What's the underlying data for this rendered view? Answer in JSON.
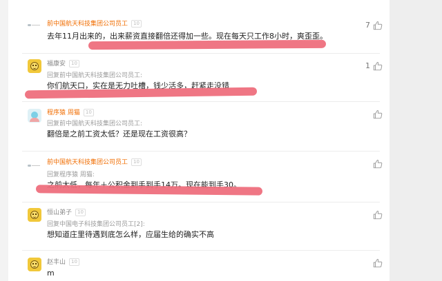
{
  "comments": [
    {
      "user": "前中国航天科技集团公司员工",
      "level": "10",
      "reply_to": "",
      "text": "去年11月出来的，出来薪资直接翻倍还得加一些。现在每天只工作8小时，爽歪歪。",
      "likes": "7"
    },
    {
      "user": "福康安",
      "level": "10",
      "reply_to": "回复前中国航天科技集团公司员工:",
      "text": "你们航天口，实在是无力吐槽，钱少活多，赶紧走没错",
      "likes": "1"
    },
    {
      "user": "程序猿 周猫",
      "level": "10",
      "reply_to": "回复前中国航天科技集团公司员工:",
      "text": "翻倍是之前工资太低？还是现在工资很高？",
      "likes": ""
    },
    {
      "user": "前中国航天科技集团公司员工",
      "level": "10",
      "reply_to": "回复程序猿 周猫:",
      "text": "之前太低，每年＋公积金到手到手14万。现在能到手30。",
      "likes": ""
    },
    {
      "user": "恒山弟子",
      "level": "10",
      "reply_to": "回复中国电子科技集团公司员工[2]:",
      "text": "想知道庄里待遇到底怎么样，应届生给的确实不高",
      "likes": ""
    },
    {
      "user": "赵丰山",
      "level": "10",
      "reply_to": "",
      "text": "m",
      "likes": ""
    }
  ],
  "colors": {
    "highlight": "#ee6c7b",
    "username_orange": "#f06c00",
    "username_gray": "#888888"
  },
  "icons": [
    "thumbs-up-icon",
    "avatar-default",
    "avatar-emoji",
    "avatar-cartoon"
  ]
}
